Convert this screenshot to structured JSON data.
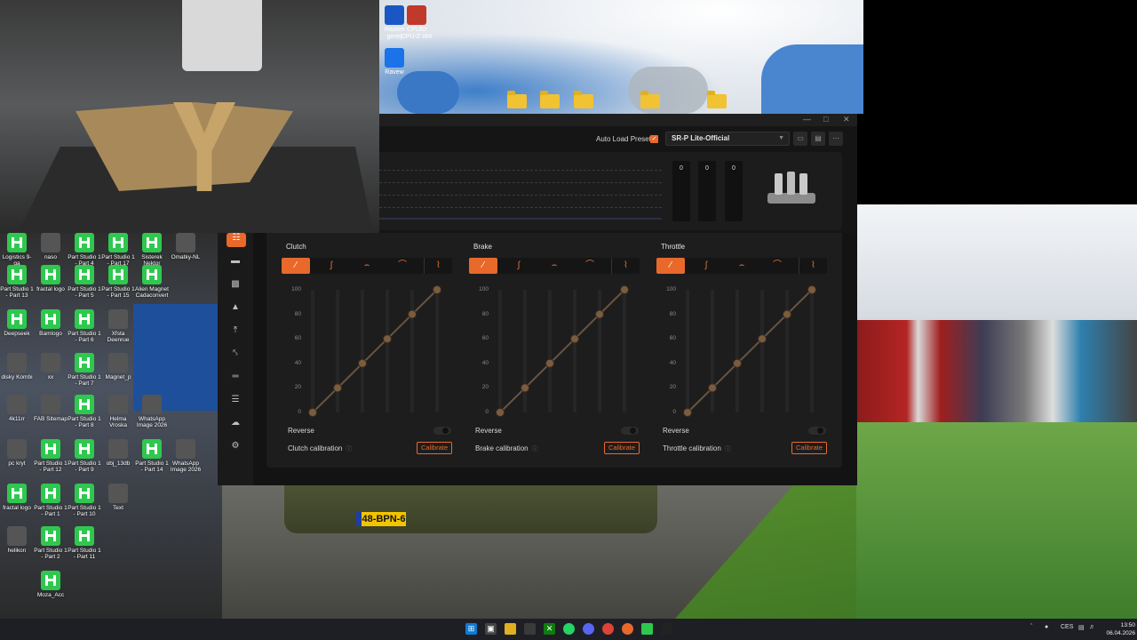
{
  "desktop_top_icons": [
    {
      "label": "Razem\ngenej",
      "color": "#1b57c4"
    },
    {
      "label": "CPUID\nCPU-Z x64",
      "color": "#c0392b"
    },
    {
      "label": "Ravew",
      "color": "#1a73e8"
    }
  ],
  "desktop_icons": [
    {
      "label": "Logistics 9-ga"
    },
    {
      "label": "naso"
    },
    {
      "label": "Part Studio 1 - Part 4"
    },
    {
      "label": "Part Studio 1 - Part 17"
    },
    {
      "label": "Sisterek Nektor"
    },
    {
      "label": "Omatky-NL"
    },
    {
      "label": "Part Studio 1 - Part 13"
    },
    {
      "label": "fractal logo"
    },
    {
      "label": "Part Studio 1 - Part 5"
    },
    {
      "label": "Part Studio 1 - Part 15"
    },
    {
      "label": "Alien Magnet Cadaconvert"
    },
    {
      "label": "Deepseek"
    },
    {
      "label": "Bamlogo"
    },
    {
      "label": "Part Studio 1 - Part 6"
    },
    {
      "label": "Xfsta Deenrue"
    },
    {
      "label": "disky Kombi"
    },
    {
      "label": "xx"
    },
    {
      "label": "Part Studio 1 - Part 7"
    },
    {
      "label": "Magnet_p"
    },
    {
      "label": "4k11rr"
    },
    {
      "label": "FAB Sitemap"
    },
    {
      "label": "Part Studio 1 - Part 8"
    },
    {
      "label": "Helma Vroska"
    },
    {
      "label": "WhatsApp Image 2026"
    },
    {
      "label": "pc kryt"
    },
    {
      "label": "Part Studio 1 - Part 12"
    },
    {
      "label": "Part Studio 1 - Part 9"
    },
    {
      "label": "obj_13db"
    },
    {
      "label": "Part Studio 1 - Part 14"
    },
    {
      "label": "WhatsApp Image 2026"
    },
    {
      "label": "fractal logo"
    },
    {
      "label": "Part Studio 1 - Part 1"
    },
    {
      "label": "Part Studio 1 - Part 10"
    },
    {
      "label": "Text"
    },
    {
      "label": "helikon"
    },
    {
      "label": "Part Studio 1 - Part 2"
    },
    {
      "label": "Part Studio 1 - Part 11"
    },
    {
      "label": "Moza_Acc"
    }
  ],
  "app": {
    "auto_load_preset_label": "Auto Load Preset",
    "auto_load_checked": true,
    "preset_value": "SR-P Lite-Official",
    "bars": [
      "0",
      "0",
      "0"
    ],
    "accent": "#e8692a",
    "sidebar_icons": [
      "pedal-icon",
      "monitor-icon",
      "gauge-icon",
      "foot-icon",
      "lever-icon",
      "brake-icon",
      "dash-icon",
      "library-icon",
      "cloud-icon",
      "settings-icon"
    ],
    "panels": [
      {
        "title": "Clutch",
        "reverse_label": "Reverse",
        "calibration_label": "Clutch calibration",
        "calibrate_label": "Calibrate"
      },
      {
        "title": "Brake",
        "reverse_label": "Reverse",
        "calibration_label": "Brake calibration",
        "calibrate_label": "Calibrate"
      },
      {
        "title": "Throttle",
        "reverse_label": "Reverse",
        "calibration_label": "Throttle calibration",
        "calibrate_label": "Calibrate"
      }
    ],
    "y_ticks": [
      "100",
      "80",
      "60",
      "40",
      "20",
      "0"
    ],
    "curve_points": [
      0,
      20,
      40,
      60,
      80,
      100
    ]
  },
  "plate_text": "48-BPN-6",
  "taskbar": {
    "language": "CES",
    "time": "13:50",
    "date": "06.04.2026"
  }
}
